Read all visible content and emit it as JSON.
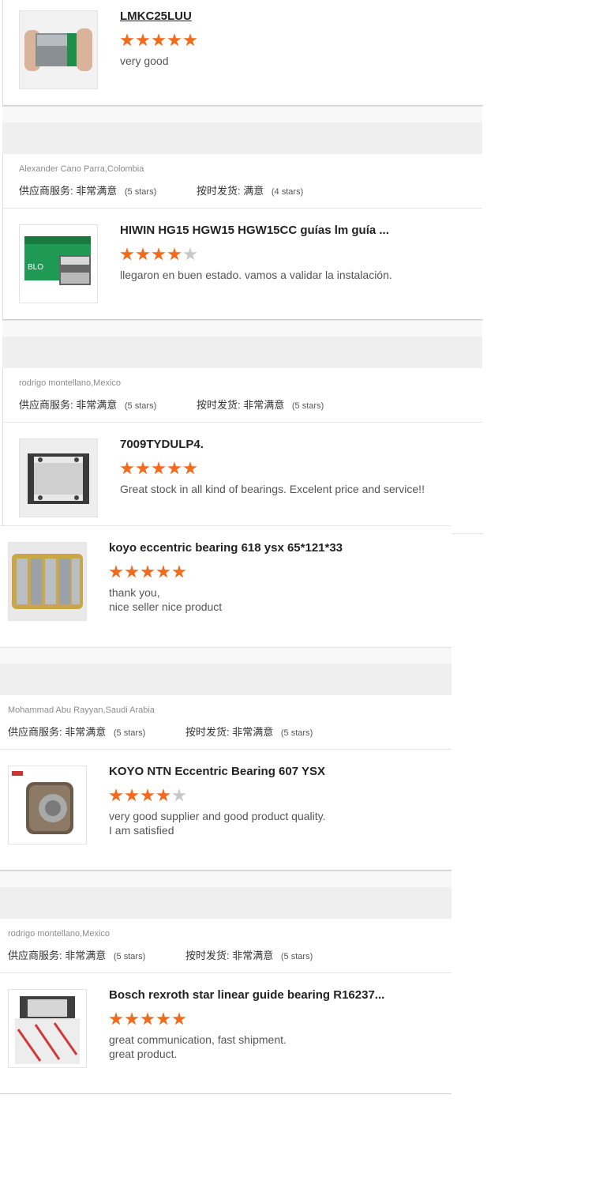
{
  "colors": {
    "star_on": "#f26b1d",
    "star_off": "#c8c8c8",
    "band": "#efefef"
  },
  "labels": {
    "service": "供应商服务:",
    "delivery": "按时发货:"
  },
  "reviews": [
    {
      "reviewer": "",
      "product": "LMKC25LUU",
      "stars": 5,
      "comment": [
        "very good"
      ]
    },
    {
      "reviewer": "Alexander Cano Parra,Colombia",
      "service_value": "非常满意",
      "service_stars": "(5 stars)",
      "delivery_value": "满意",
      "delivery_stars": "(4 stars)",
      "product": "HIWIN HG15 HGW15 HGW15CC guías lm guía ...",
      "stars": 4,
      "comment": [
        "llegaron en buen estado. vamos a validar la instalación."
      ]
    },
    {
      "reviewer": "rodrigo montellano,Mexico",
      "service_value": "非常满意",
      "service_stars": "(5 stars)",
      "delivery_value": "非常满意",
      "delivery_stars": "(5 stars)",
      "product": "7009TYDULP4.",
      "stars": 5,
      "comment": [
        "Great stock in all kind of bearings. Excelent price and service!!"
      ]
    },
    {
      "reviewer": "",
      "product": "koyo eccentric bearing 618 ysx 65*121*33",
      "stars": 5,
      "comment": [
        "thank you,",
        "nice seller nice product"
      ]
    },
    {
      "reviewer": "Mohammad Abu Rayyan,Saudi Arabia",
      "service_value": "非常满意",
      "service_stars": "(5 stars)",
      "delivery_value": "非常满意",
      "delivery_stars": "(5 stars)",
      "product": "KOYO NTN Eccentric Bearing 607 YSX",
      "stars": 4,
      "comment": [
        "very good supplier and good product quality.",
        "I am satisfied"
      ]
    },
    {
      "reviewer": "rodrigo montellano,Mexico",
      "service_value": "非常满意",
      "service_stars": "(5 stars)",
      "delivery_value": "非常满意",
      "delivery_stars": "(5 stars)",
      "product": "Bosch rexroth star linear guide bearing R16237...",
      "stars": 5,
      "comment": [
        "great communication, fast shipment.",
        "great product."
      ]
    }
  ]
}
